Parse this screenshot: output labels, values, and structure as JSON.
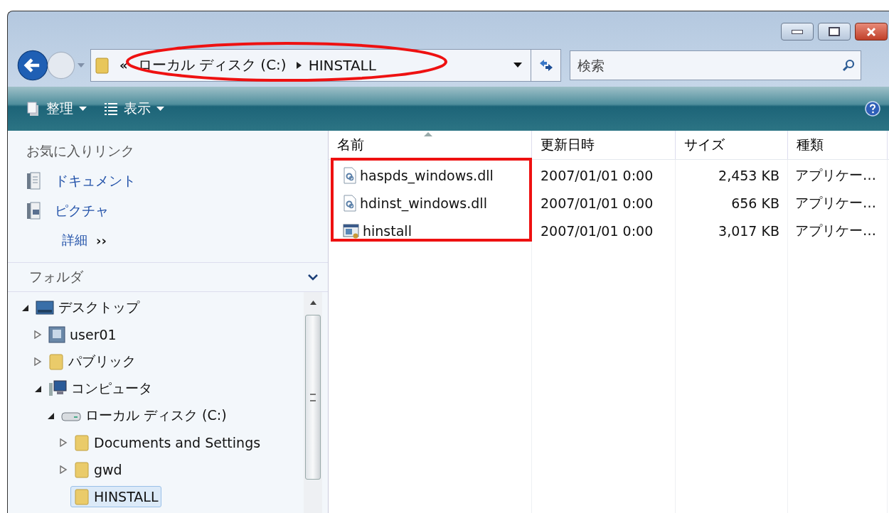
{
  "address": {
    "overflow": "«",
    "crumbs": [
      "ローカル ディスク (C:)",
      "HINSTALL"
    ]
  },
  "search": {
    "placeholder": "検索"
  },
  "toolbar": {
    "items": [
      "整理",
      "表示"
    ]
  },
  "sidebar": {
    "favorites_title": "お気に入りリンク",
    "favorites": [
      {
        "label": "ドキュメント",
        "kind": "documents"
      },
      {
        "label": "ピクチャ",
        "kind": "pictures"
      }
    ],
    "more": {
      "label": "詳細",
      "chevron": "››"
    },
    "folders_title": "フォルダ",
    "tree": [
      {
        "label": "デスクトップ",
        "kind": "desktop",
        "expandable": true,
        "expanded": true,
        "selected": false,
        "children": [
          {
            "label": "user01",
            "kind": "user",
            "expandable": true,
            "expanded": false,
            "selected": false
          },
          {
            "label": "パブリック",
            "kind": "folder",
            "expandable": true,
            "expanded": false,
            "selected": false
          },
          {
            "label": "コンピュータ",
            "kind": "computer",
            "expandable": true,
            "expanded": true,
            "selected": false,
            "children": [
              {
                "label": "ローカル ディスク (C:)",
                "kind": "drive",
                "expandable": true,
                "expanded": true,
                "selected": false,
                "children": [
                  {
                    "label": "Documents and Settings",
                    "kind": "folder",
                    "expandable": true,
                    "expanded": false,
                    "selected": false
                  },
                  {
                    "label": "gwd",
                    "kind": "folder",
                    "expandable": true,
                    "expanded": false,
                    "selected": false
                  },
                  {
                    "label": "HINSTALL",
                    "kind": "folder",
                    "expandable": false,
                    "selected": true
                  }
                ]
              }
            ]
          }
        ]
      }
    ]
  },
  "table": {
    "columns": [
      {
        "label": "名前",
        "sorted": true
      },
      {
        "label": "更新日時",
        "sorted": false
      },
      {
        "label": "サイズ",
        "sorted": false
      },
      {
        "label": "種類",
        "sorted": false
      }
    ],
    "rows": [
      {
        "kind": "dll",
        "cells": [
          "haspds_windows.dll",
          "2007/01/01 0:00",
          "2,453 KB",
          "アプリケー…"
        ]
      },
      {
        "kind": "dll",
        "cells": [
          "hdinst_windows.dll",
          "2007/01/01 0:00",
          "656 KB",
          "アプリケー…"
        ]
      },
      {
        "kind": "exe",
        "cells": [
          "hinstall",
          "2007/01/01 0:00",
          "3,017 KB",
          "アプリケー…"
        ]
      }
    ]
  }
}
